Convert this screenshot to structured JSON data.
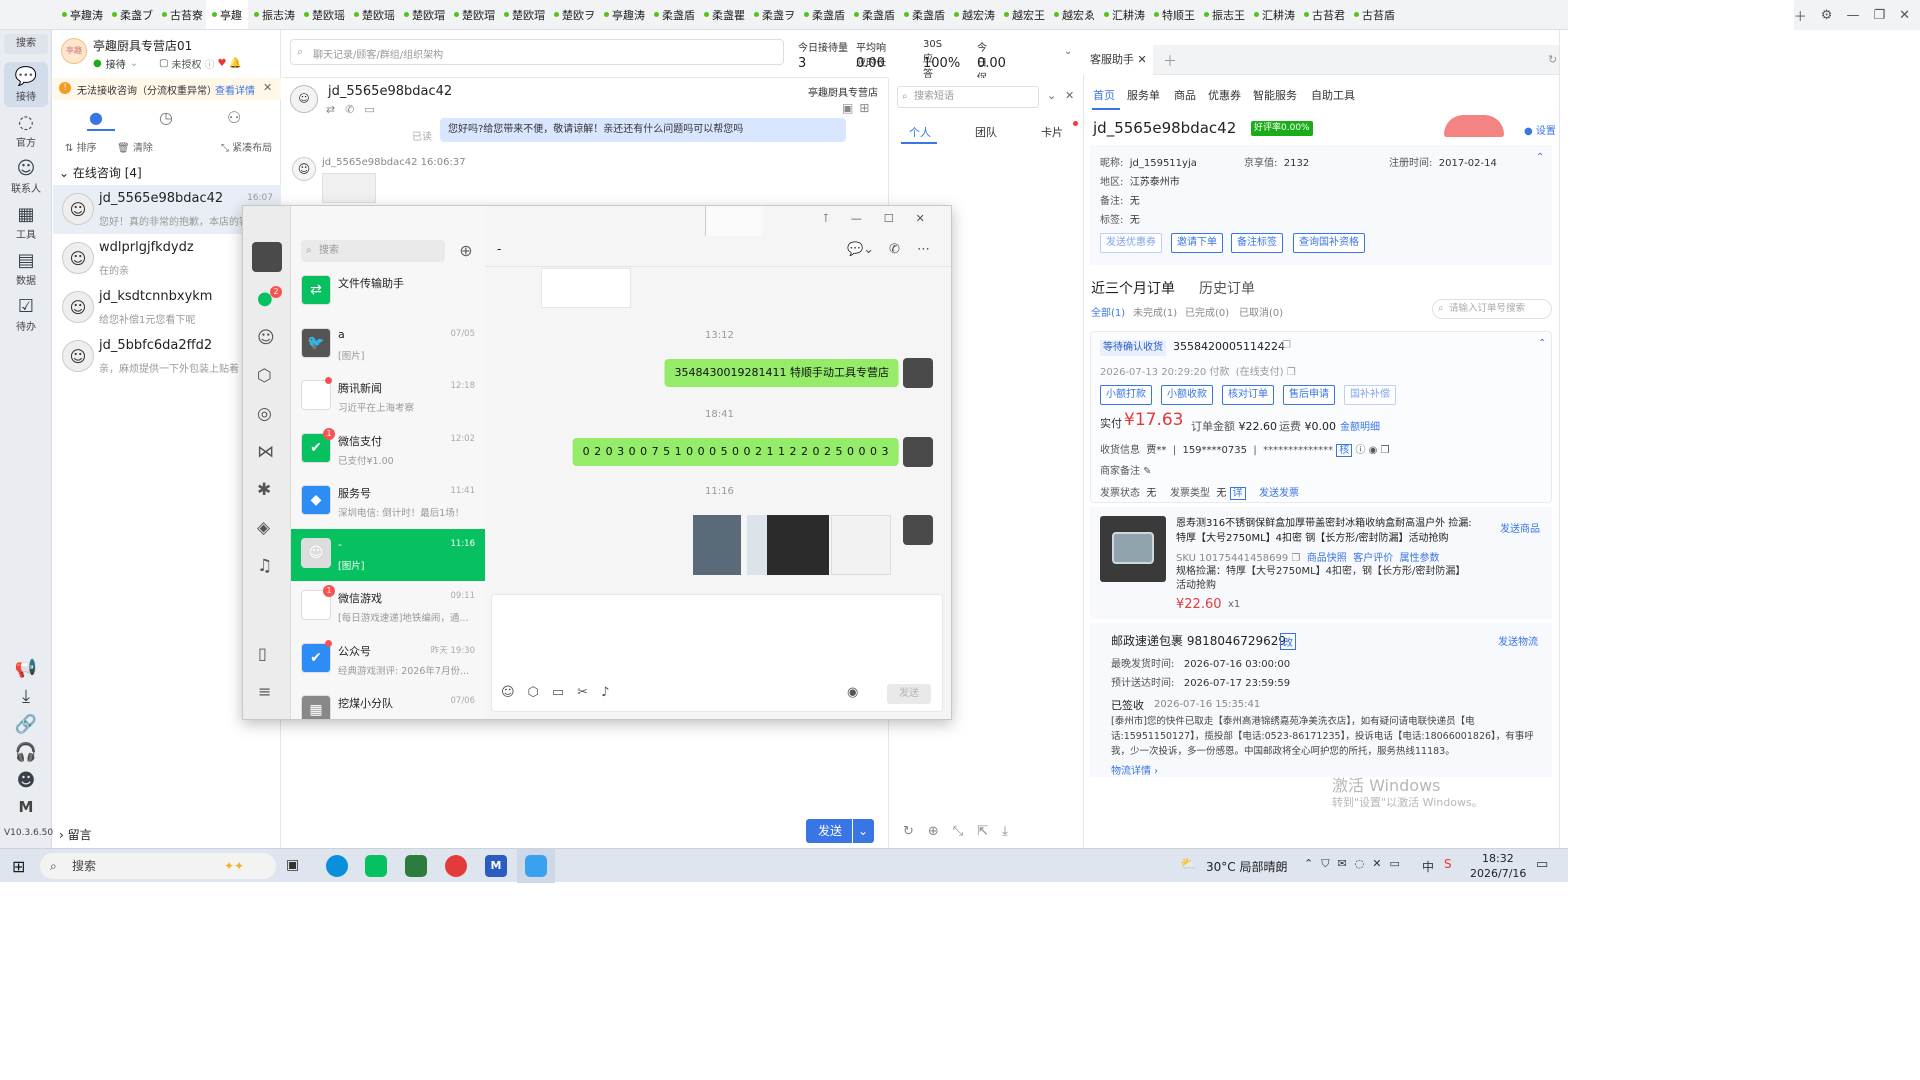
{
  "tabs": [
    "亭趣涛",
    "柔盏ブ",
    "古苔寮",
    "亭趣",
    "振志涛",
    "楚欧瑶",
    "楚欧瑶",
    "楚欧瑁",
    "楚欧瑁",
    "楚欧瑁",
    "楚欧ヲ",
    "亭趣涛",
    "柔盏盾",
    "柔盏瞿",
    "柔盏ヲ",
    "柔盏盾",
    "柔盏盾",
    "柔盏盾",
    "越宏涛",
    "越宏王",
    "越宏ゑ",
    "汇耕涛",
    "特顺王",
    "振志王",
    "汇耕涛",
    "古苔君",
    "古苔盾"
  ],
  "active_tab_index": 3,
  "leftnav": {
    "search": "搜索",
    "items": [
      "接待",
      "官方",
      "联系人",
      "工具",
      "数据",
      "待办"
    ],
    "version": "V10.3.6.500"
  },
  "shop": {
    "name": "亭趣厨具专营店01",
    "status_reception": "接待",
    "status_auth": "未授权"
  },
  "warning": {
    "text": "无法接收咨询（分流权重异常）",
    "link": "查看详情"
  },
  "list_actions": {
    "sort": "排序",
    "clear": "清除",
    "layout": "紧凑布局"
  },
  "online_section": "在线咨询 [4]",
  "message_section": "留言",
  "conversations": [
    {
      "name": "jd_5565e98bdac42",
      "time": "16:07",
      "preview": "您好！真的非常的抱歉，本店的客"
    },
    {
      "name": "wdlprlgjfkdydz",
      "time": "",
      "preview": "在的亲"
    },
    {
      "name": "jd_ksdtcnnbxykm",
      "time": "",
      "preview": "给您补偿1元您看下呢"
    },
    {
      "name": "jd_5bbfc6da2ffd2",
      "time": "",
      "preview": "亲，麻烦提供一下外包装上贴着"
    }
  ],
  "chat_search_placeholder": "聊天记录/顾客/群组/组织架构",
  "stats": [
    {
      "label": "今日接待量",
      "value": "3"
    },
    {
      "label": "平均响应时长",
      "value": "0.00"
    },
    {
      "label": "30S应答率",
      "value": "100%"
    },
    {
      "label": "今日促成下单金额",
      "value": "0.00"
    }
  ],
  "chat_header": {
    "user": "jd_5565e98bdac42",
    "shop": "亭趣厨具专营店"
  },
  "chat_msgs": {
    "read": "已读",
    "top_msg": "您好吗?给您带来不便，敬请谅解！亲还还有什么问题吗可以帮您吗",
    "sender": "jd_5565e98bdac42 16:06:37"
  },
  "chat_send": "发送",
  "quick_reply": {
    "placeholder": "搜索短语",
    "tabs": [
      "个人",
      "团队",
      "卡片"
    ]
  },
  "right_panel": {
    "tab": "客服助手",
    "nav": [
      "首页",
      "服务单",
      "商品",
      "优惠券",
      "智能服务",
      "自助工具"
    ],
    "customer_id": "jd_5565e98bdac42",
    "good_rate": "好评率0.00%",
    "settings": "设置",
    "nickname_label": "昵称:",
    "nickname": "jd_159511yja",
    "jingxiang_label": "京享值:",
    "jingxiang": "2132",
    "reg_label": "注册时间:",
    "reg": "2017-02-14",
    "region_label": "地区:",
    "region": "江苏泰州市",
    "remark_label": "备注:",
    "remark": "无",
    "tag_label": "标签:",
    "tag": "无",
    "btns": [
      "发送优惠券",
      "邀请下单",
      "备注标签",
      "查询国补资格"
    ],
    "order_tabs": [
      "近三个月订单",
      "历史订单"
    ],
    "order_filters": [
      "全部(1)",
      "未完成(1)",
      "已完成(0)",
      "已取消(0)"
    ],
    "order_search": "请输入订单号搜索",
    "order": {
      "status": "等待确认收货",
      "id": "3558420005114224",
      "time": "2026-07-13 20:29:20 付款",
      "pay": "(在线支付)",
      "btns": [
        "小额打款",
        "小额收款",
        "核对订单",
        "售后申请",
        "国补补偿"
      ],
      "paid_label": "实付",
      "paid": "¥17.63",
      "amount_label": "订单金额",
      "amount": "¥22.60",
      "freight_label": "运费",
      "freight": "¥0.00",
      "amount_detail": "金额明细",
      "receiver_label": "收货信息",
      "receiver": "贾**",
      "phone": "159****0735",
      "addr": "**************",
      "merchant_remark": "商家备注",
      "invoice_status_label": "发票状态",
      "invoice_status": "无",
      "invoice_type_label": "发票类型",
      "invoice_type": "无",
      "invoice_detail": "详",
      "send_invoice": "发送发票"
    },
    "product": {
      "title": "恩寿测316不锈钢保鲜盒加厚带盖密封冰箱收纳盒耐高温户外 捡漏: 特厚【大号2750ML】4扣密 钢【长方形/密封防漏】活动抢购",
      "send": "发送商品",
      "sku": "SKU 10175441458699",
      "links": [
        "商品快照",
        "客户评价",
        "属性参数"
      ],
      "spec": "规格捡漏：特厚【大号2750ML】4扣密，钢【长方形/密封防漏】活动抢购",
      "price": "¥22.60",
      "qty": "x1"
    },
    "logistics": {
      "title": "邮政速递包裹 9818046729629",
      "change": "改",
      "track": "发送物流",
      "latest_ship_label": "最晚发货时间:",
      "latest_ship": "2026-07-16 03:00:00",
      "eta_label": "预计送达时间:",
      "eta": "2026-07-17 23:59:59",
      "signed": "已签收",
      "signed_time": "2026-07-16 15:35:41",
      "detail": "[泰州市]您的快件已取走【泰州高港锦绣嘉苑净美洗衣店】，如有疑问请电联快递员【电话:15951150127】，揽投部【电话:0523-86171235】，投诉电话【电话:18066001826】，有事呼我，少一次投诉，多一份感恩。中国邮政将全心呵护您的所托，服务热线11183。",
      "more": "物流详情"
    }
  },
  "wechat": {
    "search": "搜索",
    "chat_title": "-",
    "chats": [
      {
        "title": "文件传输助手",
        "sub": "",
        "time": "",
        "color": "#07c160",
        "glyph": "⇄"
      },
      {
        "title": "a",
        "sub": "[图片]",
        "time": "07/05",
        "color": "#555",
        "glyph": "🐦"
      },
      {
        "title": "腾讯新闻",
        "sub": "习近平在上海考察",
        "time": "12:18",
        "color": "#fff",
        "glyph": "◉"
      },
      {
        "title": "微信支付",
        "sub": "已支付¥1.00",
        "time": "12:02",
        "color": "#07c160",
        "glyph": "✔"
      },
      {
        "title": "服务号",
        "sub": "深圳电信: 倒计时！最后1场！",
        "time": "11:41",
        "color": "#2e8df5",
        "glyph": "◆"
      },
      {
        "title": "-",
        "sub": "[图片]",
        "time": "11:16",
        "color": "#ddd",
        "glyph": "☺"
      },
      {
        "title": "微信游戏",
        "sub": "[每日游戏速递]地铁编闹，通...",
        "time": "09:11",
        "color": "#fff",
        "glyph": "✦"
      },
      {
        "title": "公众号",
        "sub": "经典游戏测评: 2026年7月份...",
        "time": "昨天 19:30",
        "color": "#2e8df5",
        "glyph": "✔"
      },
      {
        "title": "挖煤小分队",
        "sub": "",
        "time": "07/06",
        "color": "#888",
        "glyph": "▦"
      }
    ],
    "time1": "13:12",
    "msg1": "3548430019281411  特顺手动工具专营店",
    "time2": "18:41",
    "msg2": "0 2 0 3 0 0 7 5 1 0 0 0 5 0 0 2 1 1 2 2 0 2 5 0 0 0 3",
    "time3": "11:16",
    "send": "发送"
  },
  "windows_activation": {
    "line1": "激活 Windows",
    "line2": "转到\"设置\"以激活 Windows。"
  },
  "taskbar": {
    "search": "搜索",
    "weather": "30°C  局部晴朗",
    "ime": "中",
    "time": "18:32",
    "date": "2026/7/16"
  }
}
